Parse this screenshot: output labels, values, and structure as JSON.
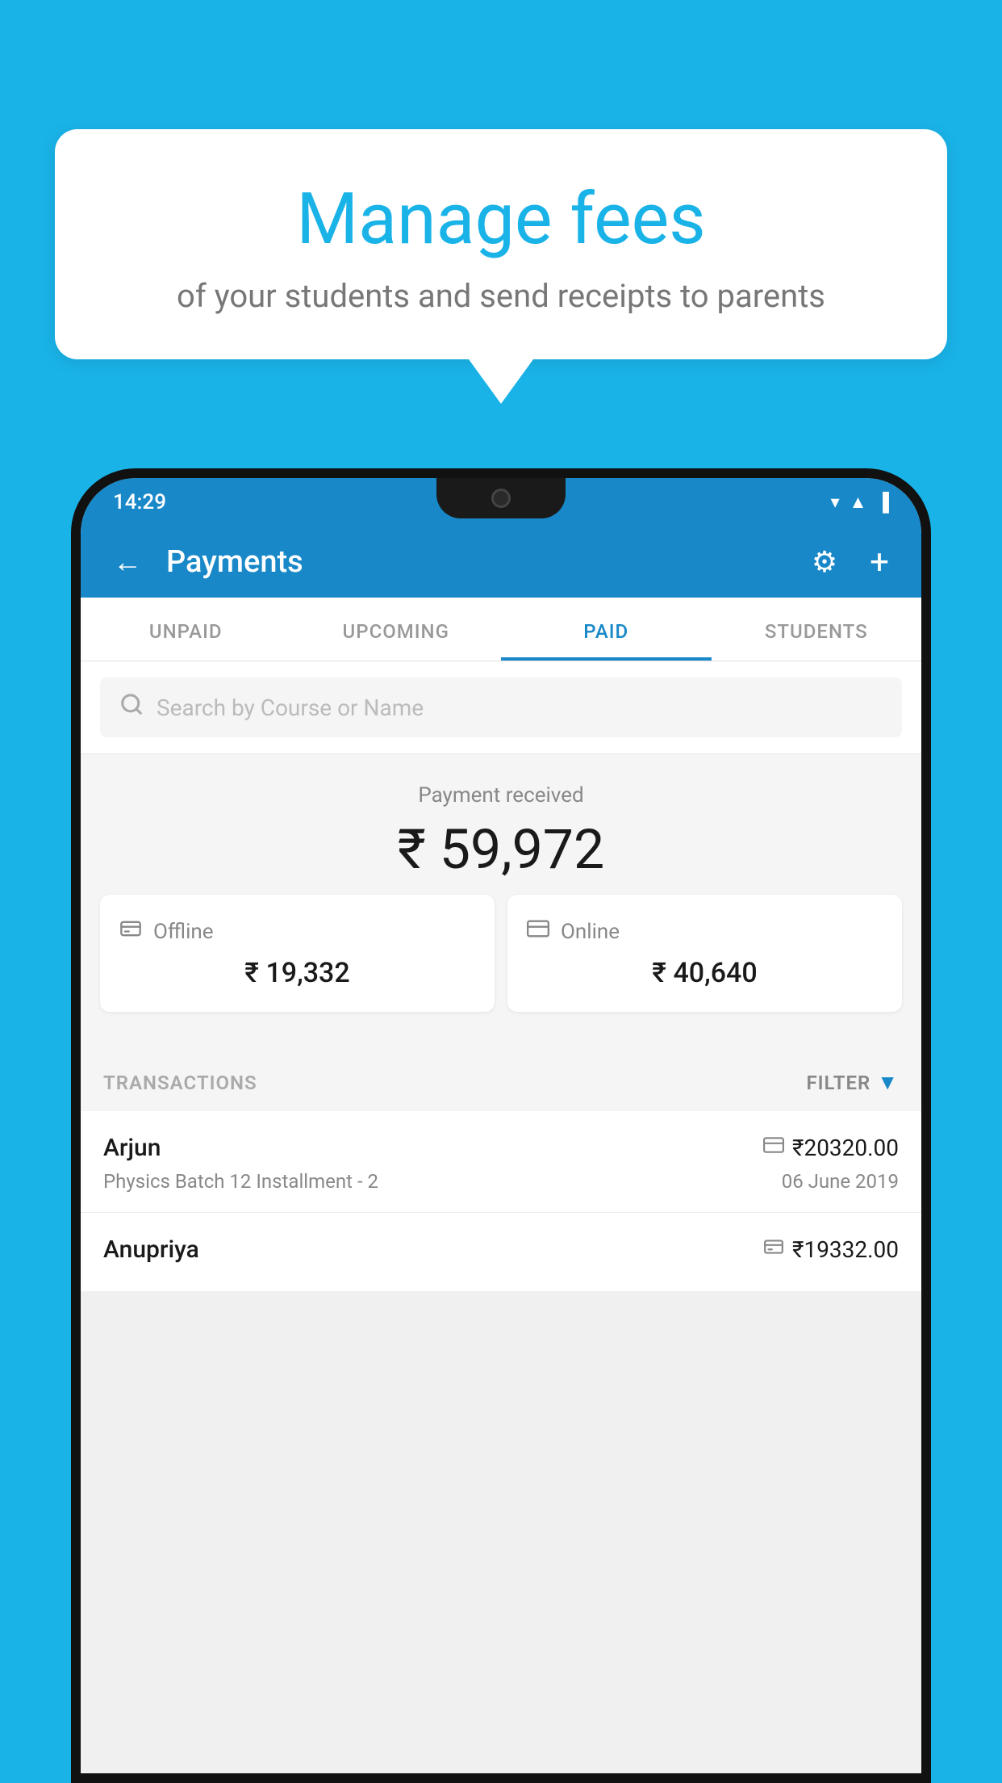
{
  "background_color": "#1ab3e8",
  "speech_bubble": {
    "title": "Manage fees",
    "subtitle": "of your students and send receipts to parents"
  },
  "phone": {
    "status_bar": {
      "time": "14:29",
      "icons": [
        "wifi",
        "signal",
        "battery"
      ]
    },
    "app_bar": {
      "title": "Payments",
      "back_label": "←",
      "gear_label": "⚙",
      "plus_label": "+"
    },
    "tabs": [
      {
        "label": "UNPAID",
        "active": false
      },
      {
        "label": "UPCOMING",
        "active": false
      },
      {
        "label": "PAID",
        "active": true
      },
      {
        "label": "STUDENTS",
        "active": false
      }
    ],
    "search": {
      "placeholder": "Search by Course or Name"
    },
    "payment_received": {
      "label": "Payment received",
      "amount": "₹ 59,972",
      "cards": [
        {
          "icon": "offline",
          "label": "Offline",
          "amount": "₹ 19,332"
        },
        {
          "icon": "online",
          "label": "Online",
          "amount": "₹ 40,640"
        }
      ]
    },
    "transactions": {
      "label": "TRANSACTIONS",
      "filter_label": "FILTER",
      "items": [
        {
          "name": "Arjun",
          "amount": "₹20320.00",
          "course": "Physics Batch 12 Installment - 2",
          "date": "06 June 2019",
          "payment_type": "card"
        },
        {
          "name": "Anupriya",
          "amount": "₹19332.00",
          "course": "",
          "date": "",
          "payment_type": "offline"
        }
      ]
    }
  }
}
